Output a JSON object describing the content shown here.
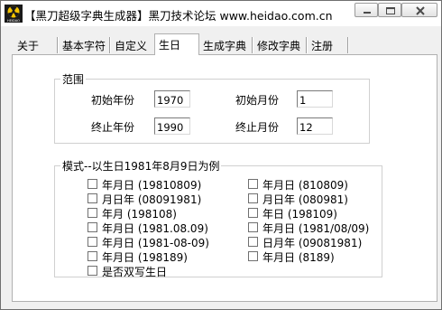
{
  "window": {
    "title": "【黑刀超级字典生成器】黑刀技术论坛 www.heidao.com.cn",
    "icon_caption": "HEIDAO"
  },
  "tabs": [
    {
      "label": "关于"
    },
    {
      "label": "基本字符"
    },
    {
      "label": "自定义"
    },
    {
      "label": "生日",
      "selected": true
    },
    {
      "label": "生成字典"
    },
    {
      "label": "修改字典"
    },
    {
      "label": "注册"
    }
  ],
  "range": {
    "legend": "范围",
    "start_year_label": "初始年份",
    "start_year_value": "1970",
    "start_month_label": "初始月份",
    "start_month_value": "1",
    "end_year_label": "终止年份",
    "end_year_value": "1990",
    "end_month_label": "终止月份",
    "end_month_value": "12"
  },
  "mode": {
    "legend": "模式--以生日1981年8月9日为例",
    "left_options": [
      {
        "label": "年月日 (19810809)",
        "checked": false
      },
      {
        "label": "月日年 (08091981)",
        "checked": false
      },
      {
        "label": "年月  (198108)",
        "checked": false
      },
      {
        "label": "年月日 (1981.08.09)",
        "checked": false
      },
      {
        "label": "年月日 (1981-08-09)",
        "checked": false
      },
      {
        "label": "年月日 (198189)",
        "checked": false
      },
      {
        "label": "是否双写生日",
        "checked": false
      }
    ],
    "right_options": [
      {
        "label": "年月日 (810809)",
        "checked": false
      },
      {
        "label": "月日年 (080981)",
        "checked": false
      },
      {
        "label": "年日  (198109)",
        "checked": false
      },
      {
        "label": "年月日 (1981/08/09)",
        "checked": false
      },
      {
        "label": "日月年 (09081981)",
        "checked": false
      },
      {
        "label": "年月日 (8189)",
        "checked": false
      }
    ]
  }
}
